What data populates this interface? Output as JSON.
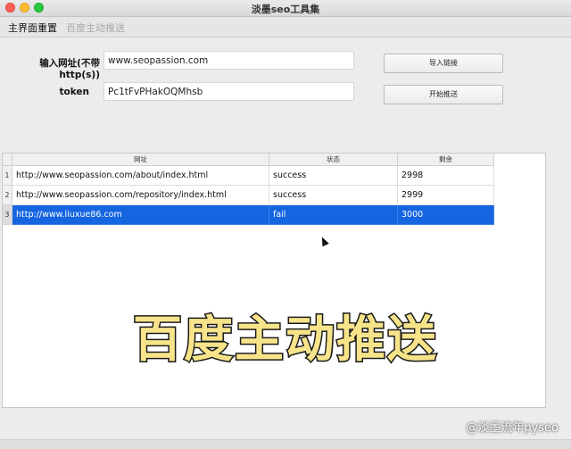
{
  "window": {
    "title": "淡墨seo工具集"
  },
  "tabs": [
    {
      "label": "主界面重置"
    },
    {
      "label": "百度主动推送"
    }
  ],
  "form": {
    "url_label": "输入网址(不带http(s))",
    "url_value": "www.seopassion.com",
    "token_label": "token",
    "token_value": "Pc1tFvPHakOQMhsb",
    "import_button": "导入链接",
    "push_button": "开始推送"
  },
  "table": {
    "columns": [
      "网址",
      "状态",
      "剩余"
    ],
    "rows": [
      {
        "num": "1",
        "url": "http://www.seopassion.com/about/index.html",
        "status": "success",
        "remaining": "2998"
      },
      {
        "num": "2",
        "url": "http://www.seopassion.com/repository/index.html",
        "status": "success",
        "remaining": "2999"
      },
      {
        "num": "3",
        "url": "http://www.liuxue86.com",
        "status": "fail",
        "remaining": "3000"
      }
    ],
    "selected_row": 3,
    "selection_color": "#1565e0"
  },
  "overlay_caption": "百度主动推送",
  "watermark": "@淡墨流年pyseo"
}
